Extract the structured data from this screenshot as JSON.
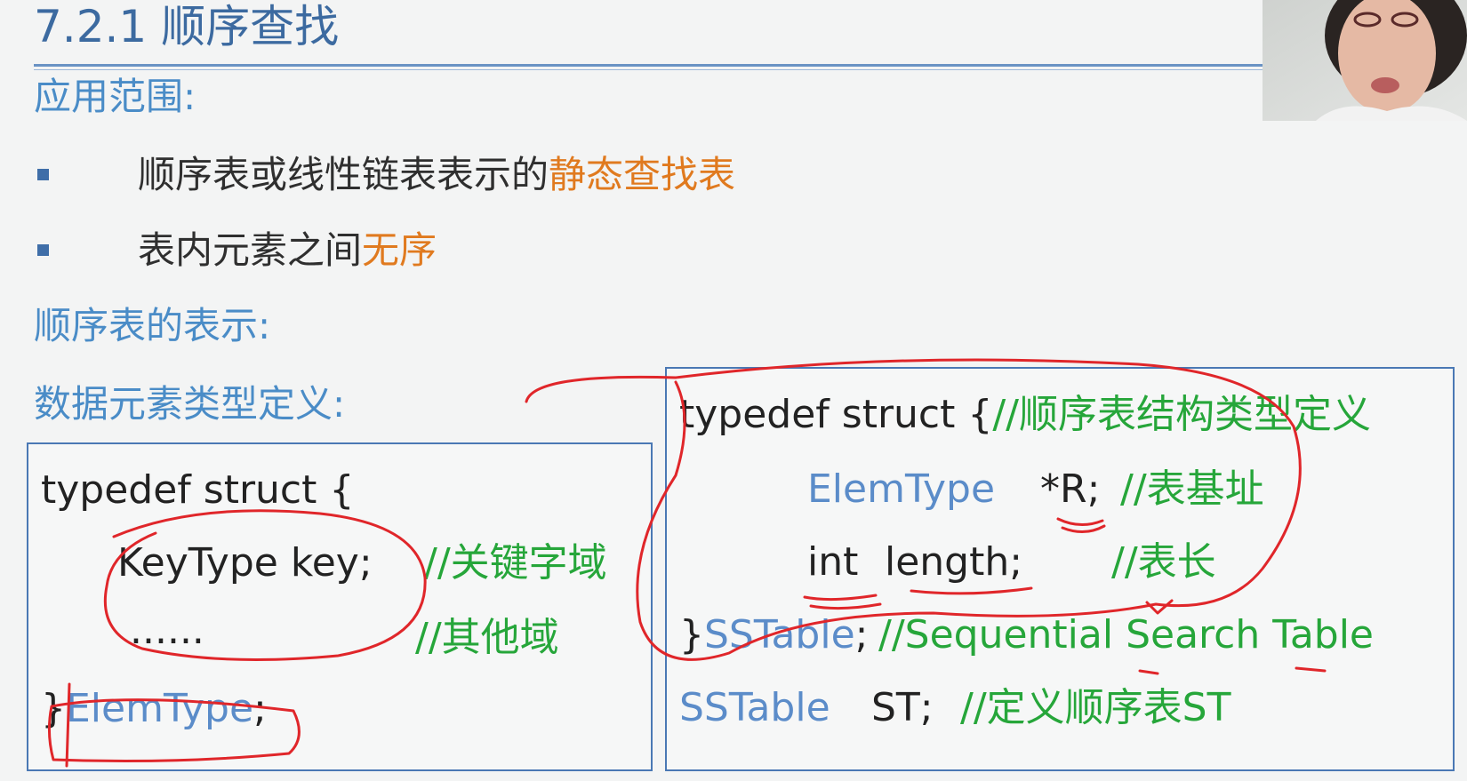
{
  "slide": {
    "title": "7.2.1 顺序查找",
    "scope_heading": "应用范围:",
    "bullets": [
      {
        "text": "顺序表或线性链表表示的",
        "highlight": "静态查找表"
      },
      {
        "text": "表内元素之间",
        "highlight": "无序"
      }
    ],
    "repr_heading": "顺序表的表示:",
    "elem_heading": "数据元素类型定义:",
    "colors": {
      "accent_blue": "#4a8cc7",
      "orange": "#e07a1f",
      "comment_green": "#26a63a",
      "annotation_red": "#e0262a"
    }
  },
  "left_code": {
    "line1": "typedef struct {",
    "keytype": "KeyType key",
    "semicolon": ";",
    "cmt1": "//关键字域",
    "dots": "......",
    "cmt2": "//其他域",
    "brace": "}",
    "elemtype": "ElemType",
    "end": ";"
  },
  "right_code": {
    "line1_code": "typedef struct {",
    "line1_cmt": "//顺序表结构类型定义",
    "l2_type": "ElemType",
    "l2_var": "*R;",
    "l2_cmt": "//表基址",
    "l3_type": "int",
    "l3_var": "length;",
    "l3_cmt": "//表长",
    "l4_brace": "}",
    "l4_type": "SSTable",
    "l4_semi": ";",
    "l4_cmt": "//Sequential Search Table",
    "l5_type": "SSTable",
    "l5_var": "ST;",
    "l5_cmt": "//定义顺序表ST"
  },
  "webcam": {
    "icon": "presenter-video-icon"
  }
}
